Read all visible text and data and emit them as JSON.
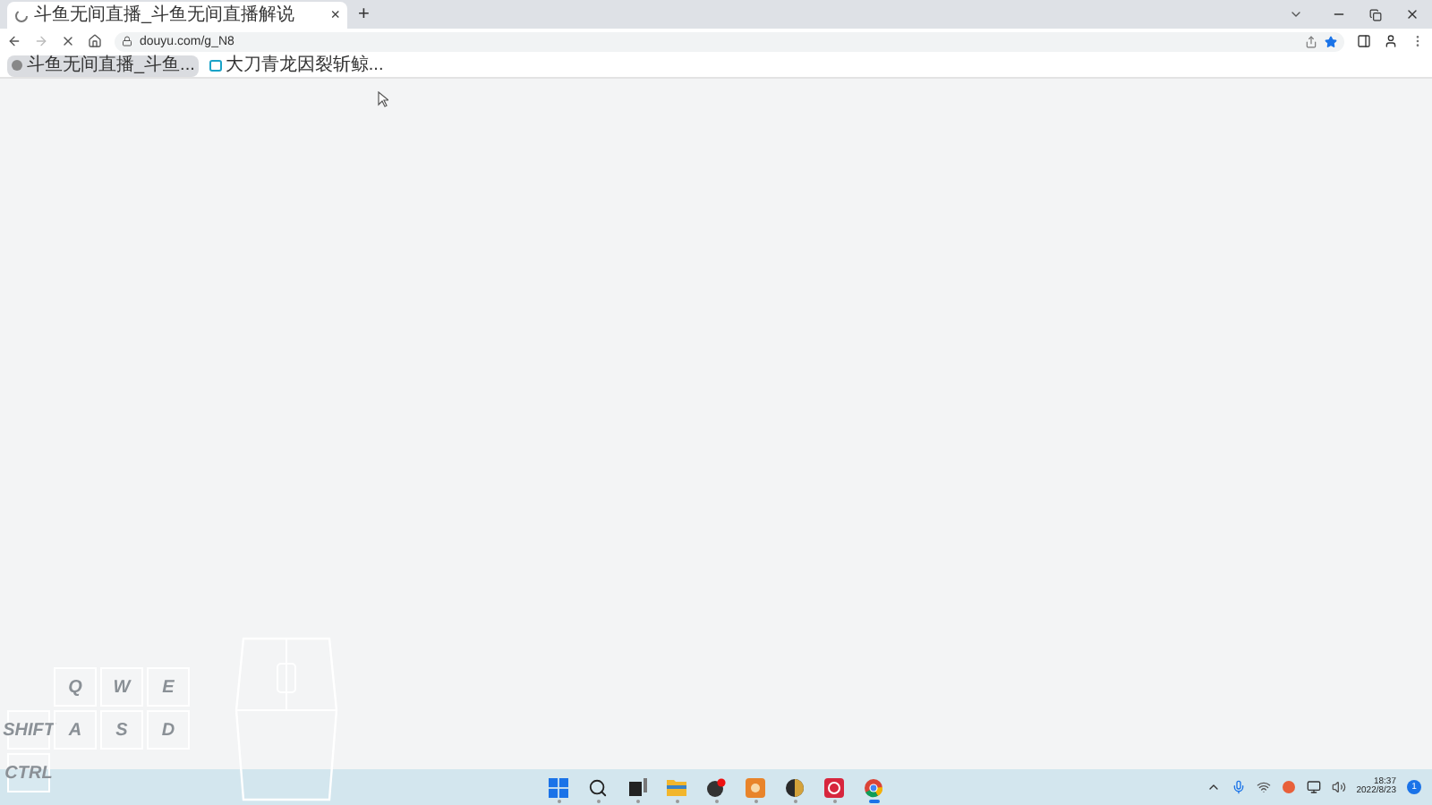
{
  "tab": {
    "title": "斗鱼无间直播_斗鱼无间直播解说",
    "close": "×",
    "new_tab": "+"
  },
  "address_bar": {
    "url": "douyu.com/g_N8",
    "bookmarked": true
  },
  "bookmarks": [
    {
      "kind": "site",
      "label": "斗鱼无间直播_斗鱼..."
    },
    {
      "kind": "app",
      "label": "大刀青龙因裂斩鲸..."
    }
  ],
  "key_overlay": {
    "rows": [
      [
        "",
        "Q",
        "W",
        "E"
      ],
      [
        "SHIFT",
        "A",
        "S",
        "D"
      ],
      [
        "CTRL"
      ]
    ]
  },
  "taskbar": {
    "apps": [
      {
        "kind": "start",
        "selected": false
      },
      {
        "kind": "search",
        "selected": false
      },
      {
        "kind": "taskview",
        "selected": false
      },
      {
        "kind": "folder",
        "selected": false
      },
      {
        "kind": "round-dark",
        "selected": false
      },
      {
        "kind": "orange",
        "selected": false
      },
      {
        "kind": "round-gold",
        "selected": false
      },
      {
        "kind": "red",
        "selected": false
      },
      {
        "kind": "browser",
        "selected": true
      }
    ],
    "time": "18:37",
    "date": "2022/8/23",
    "notifications": "1"
  }
}
